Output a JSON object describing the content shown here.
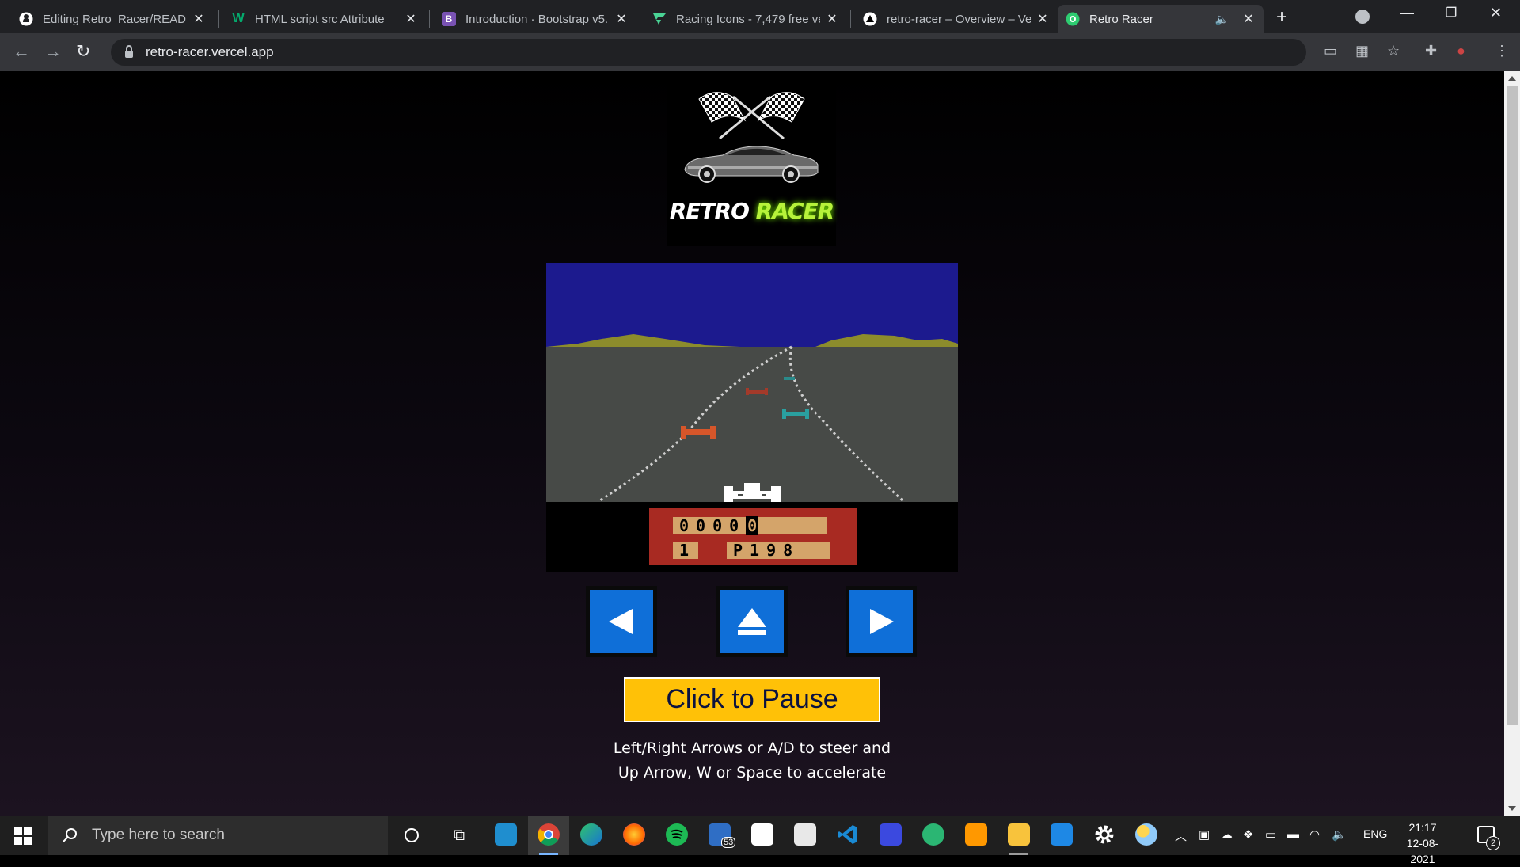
{
  "browser": {
    "tabs": [
      {
        "title": "Editing Retro_Racer/READM",
        "icon": "github-icon",
        "favicon_color": "#ffffff"
      },
      {
        "title": "HTML script src Attribute",
        "icon": "w3schools-icon",
        "favicon_color": "#04aa6d"
      },
      {
        "title": "Introduction · Bootstrap v5.",
        "icon": "bootstrap-icon",
        "favicon_color": "#7952b3"
      },
      {
        "title": "Racing Icons - 7,479 free ve",
        "icon": "flaticon-icon",
        "favicon_color": "#4ad395"
      },
      {
        "title": "retro-racer – Overview – Ver",
        "icon": "vercel-icon",
        "favicon_color": "#ffffff"
      },
      {
        "title": "Retro Racer",
        "icon": "retro-racer-icon",
        "favicon_color": "#2ecc71",
        "active": true
      }
    ],
    "url": "retro-racer.vercel.app"
  },
  "logo": {
    "word1": "RETRO",
    "word2": "RACER"
  },
  "game": {
    "colors": {
      "sky": "#1c1a8e",
      "mountains": "#8c8c2c",
      "road": "#474a47",
      "hud": "#a82a22",
      "hud_cell": "#d4a46a"
    },
    "hud": {
      "odometer": "0000",
      "odometer_last": "0",
      "day": "1",
      "cars_left": "P198"
    }
  },
  "controls": {
    "left_icon": "arrow-left-icon",
    "up_icon": "accelerate-icon",
    "right_icon": "arrow-right-icon",
    "accent_color": "#0f6fd8"
  },
  "pause_button": {
    "label": "Click to Pause",
    "color": "#ffc107"
  },
  "instructions": {
    "line1": "Left/Right Arrows or A/D to steer and",
    "line2": "Up Arrow, W or Space to accelerate"
  },
  "taskbar": {
    "search_placeholder": "Type here to search",
    "mail_badge": "53",
    "language": "ENG",
    "time": "21:17",
    "date": "12-08-2021",
    "notification_count": "2"
  }
}
